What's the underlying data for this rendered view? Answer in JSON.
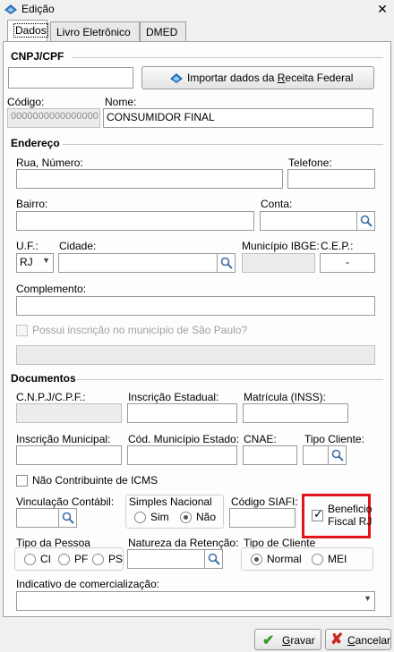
{
  "window": {
    "title": "Edição"
  },
  "tabs": [
    "Dados",
    "Livro Eletrônico",
    "DMED"
  ],
  "cnpj_section": {
    "title": "CNPJ/CPF",
    "cnpj_value": "",
    "import_label_pre": "Importar dados da ",
    "import_label_u": "R",
    "import_label_post": "eceita Federal",
    "codigo_label": "Código:",
    "codigo_value": "0000000000000000",
    "nome_label": "Nome:",
    "nome_value": "CONSUMIDOR FINAL"
  },
  "endereco": {
    "title": "Endereço",
    "rua_label": "Rua, Número:",
    "telefone_label": "Telefone:",
    "bairro_label": "Bairro:",
    "conta_label": "Conta:",
    "uf_label": "U.F.:",
    "uf_value": "RJ",
    "cidade_label": "Cidade:",
    "municipio_ibge_label": "Município IBGE:",
    "cep_label": "C.E.P.:",
    "cep_value": "-",
    "complemento_label": "Complemento:",
    "sp_checkbox_label": "Possui inscrição no município de São Paulo?"
  },
  "documentos": {
    "title": "Documentos",
    "cnpj_cpf_label": "C.N.P.J/C.P.F.:",
    "inscricao_estadual_label": "Inscrição Estadual:",
    "matricula_label": "Matrícula (INSS):",
    "inscricao_municipal_label": "Inscrição Municipal:",
    "cod_municipio_label": "Cód. Município Estado:",
    "cnae_label": "CNAE:",
    "tipo_cliente_label": "Tipo Cliente:",
    "nao_contribuinte_label": "Não Contribuinte de ICMS",
    "vinculacao_label": "Vinculação Contábil:",
    "simples_label": "Simples Nacional",
    "simples_sim": "Sim",
    "simples_nao": "Não",
    "siafi_label": "Código SIAFI:",
    "beneficio_line1": "Beneficio",
    "beneficio_line2": "Fiscal RJ",
    "tipo_pessoa_label": "Tipo da Pessoa",
    "pessoa_ci": "CI",
    "pessoa_pf": "PF",
    "pessoa_ps": "PS",
    "natureza_label": "Natureza da Retenção:",
    "tipo_de_cliente_label": "Tipo de Cliente",
    "cliente_normal": "Normal",
    "cliente_mei": "MEI",
    "indicativo_label": "Indicativo de comercialização:"
  },
  "footer": {
    "gravar_u": "G",
    "gravar_rest": "ravar",
    "cancelar_u": "C",
    "cancelar_rest": "ancelar"
  },
  "colors": {
    "highlight_red": "#e0141c",
    "check_green": "#3a9a2a",
    "cancel_red": "#c8281e"
  }
}
